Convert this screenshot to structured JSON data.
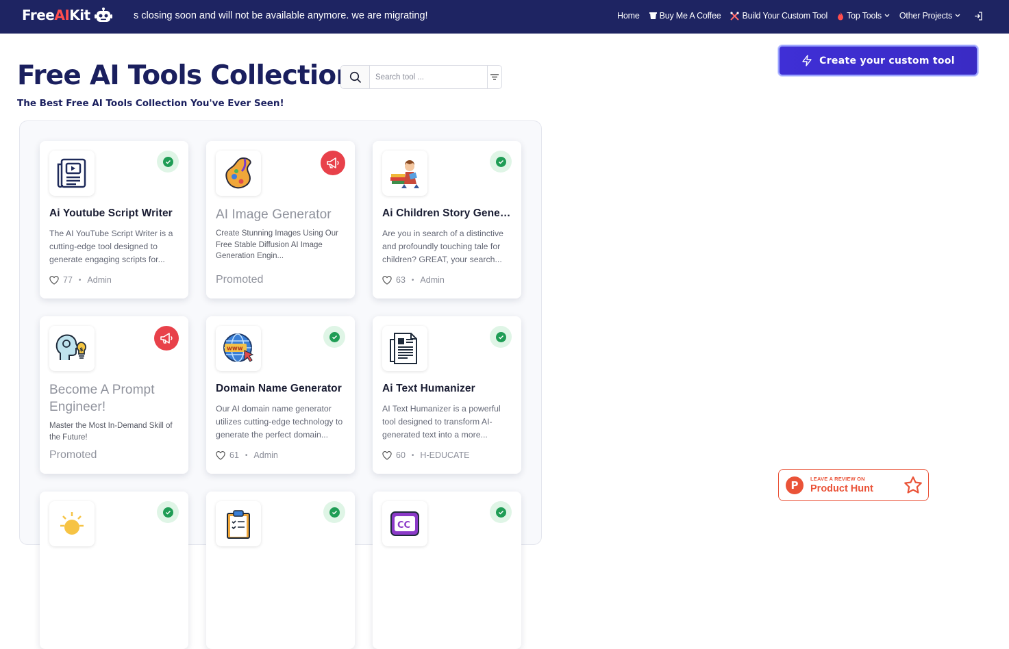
{
  "brand": {
    "name_free": "Free",
    "name_ai": "AI",
    "name_kit": "Kit"
  },
  "announcement": "s closing soon and will not be available anymore. we are migrating!",
  "nav": {
    "home": "Home",
    "coffee": "Buy Me A Coffee",
    "custom_tool": "Build Your Custom Tool",
    "top_tools": "Top Tools",
    "other_projects": "Other Projects"
  },
  "header": {
    "title": "Free AI Tools Collection",
    "subtitle": "The Best Free AI Tools Collection You've Ever Seen!"
  },
  "search": {
    "placeholder": "Search tool ..."
  },
  "cta": {
    "label": "Create your custom tool"
  },
  "cards": [
    {
      "title": "Ai Youtube Script Writer",
      "desc": "The AI YouTube Script Writer is a cutting-edge tool designed to generate engaging scripts for...",
      "likes": "77",
      "author": "Admin",
      "icon": "video-document-icon",
      "badge": "verified"
    },
    {
      "title": "AI Image Generator",
      "desc": "Create Stunning Images Using Our Free Stable Diffusion AI Image Generation Engin...",
      "promo": "Promoted",
      "icon": "paint-palette-icon",
      "badge": "promoted"
    },
    {
      "title": "Ai Children Story Generator",
      "desc": "Are you in search of a distinctive and profoundly touching tale for children? GREAT, your search...",
      "likes": "63",
      "author": "Admin",
      "icon": "child-reading-books-icon",
      "badge": "verified"
    },
    {
      "title": "Become A Prompt Engineer!",
      "desc": "Master the Most In-Demand Skill of the Future!",
      "promo": "Promoted",
      "icon": "head-idea-money-icon",
      "badge": "promoted"
    },
    {
      "title": "Domain Name Generator",
      "desc": "Our AI domain name generator utilizes cutting-edge technology to generate the perfect domain...",
      "likes": "61",
      "author": "Admin",
      "icon": "globe-www-icon",
      "badge": "verified"
    },
    {
      "title": "Ai Text Humanizer",
      "desc": "AI Text Humanizer is a powerful tool designed to transform AI-generated text into a more...",
      "likes": "60",
      "author": "H-EDUCATE",
      "icon": "text-document-icon",
      "badge": "verified"
    },
    {
      "icon": "lightbulb-icon",
      "badge": "verified"
    },
    {
      "icon": "clipboard-checklist-icon",
      "badge": "verified"
    },
    {
      "icon": "caption-cc-icon",
      "badge": "verified"
    }
  ],
  "product_hunt": {
    "small": "LEAVE A REVIEW ON",
    "big": "Product Hunt",
    "logo_letter": "P"
  },
  "colors": {
    "navbar": "#1e2462",
    "accent": "#3f2fd6",
    "promo_red": "#e8414a",
    "verified_green": "#1f9d55",
    "product_hunt": "#ea5338"
  }
}
